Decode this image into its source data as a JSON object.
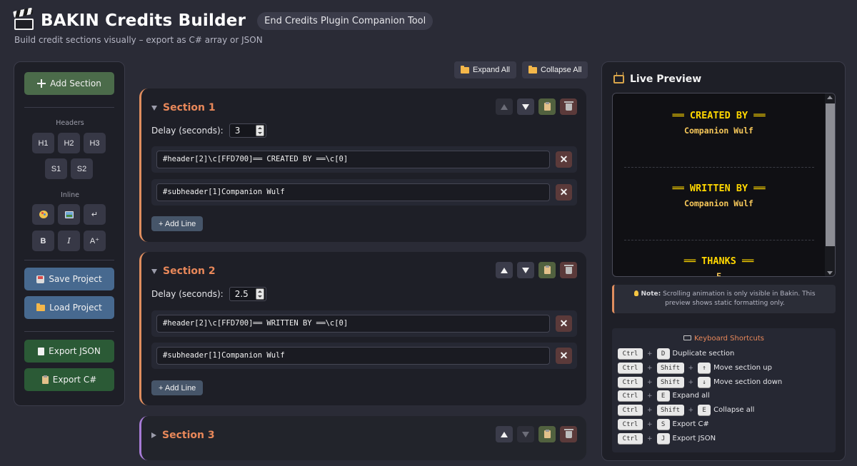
{
  "header": {
    "title": "BAKIN Credits Builder",
    "badge": "End Credits Plugin Companion Tool",
    "subtitle": "Build credit sections visually – export as C# array or JSON"
  },
  "toolbar": {
    "add_section": "Add Section",
    "headers_label": "Headers",
    "header_buttons": [
      "H1",
      "H2",
      "H3",
      "S1",
      "S2"
    ],
    "inline_label": "Inline",
    "inline_buttons": [
      "color",
      "image",
      "↵",
      "B",
      "I",
      "A⁺"
    ],
    "save_project": "Save Project",
    "load_project": "Load Project",
    "export_json": "Export JSON",
    "export_cs": "Export C#"
  },
  "controls": {
    "expand_all": "Expand All",
    "collapse_all": "Collapse All"
  },
  "sections": [
    {
      "title": "Section 1",
      "expanded": true,
      "delay_label": "Delay (seconds):",
      "delay": "3",
      "lines": [
        "#header[2]\\c[FFD700]══ CREATED BY ══\\c[0]",
        "#subheader[1]Companion Wulf"
      ],
      "add_line": "+ Add Line"
    },
    {
      "title": "Section 2",
      "expanded": true,
      "delay_label": "Delay (seconds):",
      "delay": "2.5",
      "lines": [
        "#header[2]\\c[FFD700]══ WRITTEN BY ══\\c[0]",
        "#subheader[1]Companion Wulf"
      ],
      "add_line": "+ Add Line"
    },
    {
      "title": "Section 3",
      "expanded": false
    }
  ],
  "preview": {
    "title": "Live Preview",
    "blocks": [
      {
        "header": "══ CREATED BY ══",
        "sub": "Companion Wulf"
      },
      {
        "header": "══ WRITTEN BY ══",
        "sub": "Companion Wulf"
      },
      {
        "header": "══ THANKS ══",
        "sub": "F"
      }
    ],
    "note_label": "Note:",
    "note_text": "Scrolling animation is only visible in Bakin. This preview shows static formatting only."
  },
  "shortcuts": {
    "title": "Keyboard Shortcuts",
    "items": [
      {
        "keys": [
          "Ctrl",
          "D"
        ],
        "desc": "Duplicate section"
      },
      {
        "keys": [
          "Ctrl",
          "Shift",
          "↑"
        ],
        "desc": "Move section up"
      },
      {
        "keys": [
          "Ctrl",
          "Shift",
          "↓"
        ],
        "desc": "Move section down"
      },
      {
        "keys": [
          "Ctrl",
          "E"
        ],
        "desc": "Expand all"
      },
      {
        "keys": [
          "Ctrl",
          "Shift",
          "E"
        ],
        "desc": "Collapse all"
      },
      {
        "keys": [
          "Ctrl",
          "S"
        ],
        "desc": "Export C#"
      },
      {
        "keys": [
          "Ctrl",
          "J"
        ],
        "desc": "Export JSON"
      }
    ]
  },
  "colors": {
    "accent": "#e9885a",
    "gold": "#ffd700",
    "section_collapsed_accent": "#a77bd6"
  }
}
